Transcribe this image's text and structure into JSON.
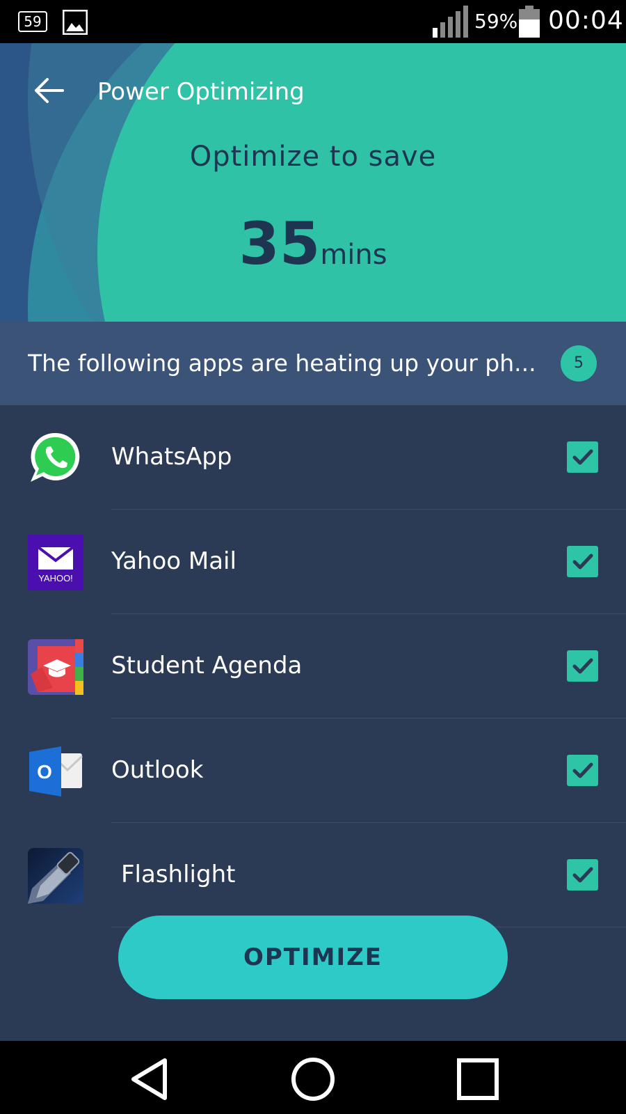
{
  "status_bar": {
    "notification_badge": "59",
    "battery_percent": "59%",
    "time": "00:04",
    "icons": [
      "notification-badge-icon",
      "image-icon",
      "signal-icon",
      "battery-icon"
    ]
  },
  "header": {
    "title": "Power Optimizing",
    "subtitle": "Optimize to save",
    "saving_value": "35",
    "saving_unit": "mins"
  },
  "banner": {
    "text": "The following apps are heating up your ph...",
    "count": "5"
  },
  "apps": [
    {
      "name": "WhatsApp",
      "icon": "whatsapp-icon",
      "checked": true
    },
    {
      "name": "Yahoo Mail",
      "icon": "yahoo-mail-icon",
      "checked": true
    },
    {
      "name": "Student Agenda",
      "icon": "student-agenda-icon",
      "checked": true
    },
    {
      "name": "Outlook",
      "icon": "outlook-icon",
      "checked": true
    },
    {
      "name": "Flashlight",
      "icon": "flashlight-icon",
      "checked": true
    }
  ],
  "yahoo_logo_text": "YAHOO!",
  "outlook_logo_letter": "O",
  "optimize_button": "OPTIMIZE",
  "colors": {
    "accent": "#2ec4a6",
    "button": "#2ecac8",
    "list_background": "#2b3a55",
    "banner_background": "#3a5377",
    "dark_text": "#1e3551"
  }
}
